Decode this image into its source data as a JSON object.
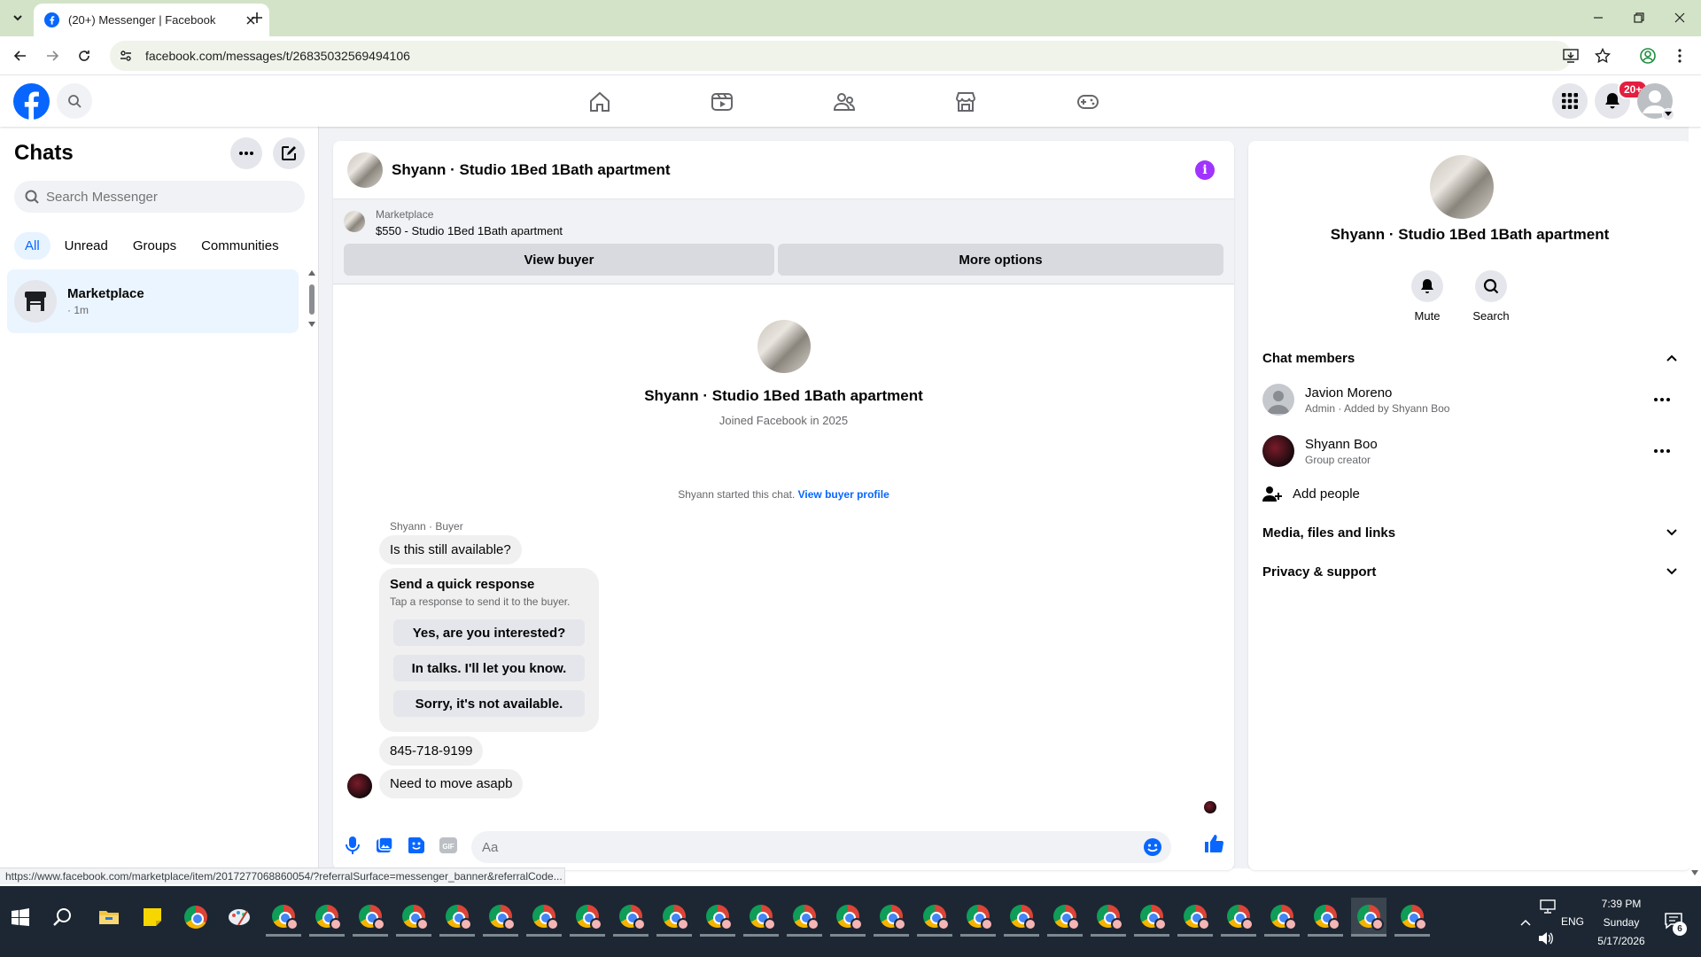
{
  "browser": {
    "tab_title": "(20+) Messenger | Facebook",
    "url": "facebook.com/messages/t/26835032569494106",
    "status_url": "https://www.facebook.com/marketplace/item/2017277068860054/?referralSurface=messenger_banner&referralCode..."
  },
  "fbnav": {
    "notif_badge": "20+",
    "icons": [
      "home-icon",
      "watch-icon",
      "friends-icon",
      "marketplace-icon",
      "gaming-icon"
    ]
  },
  "left": {
    "title": "Chats",
    "search_placeholder": "Search Messenger",
    "filters": [
      "All",
      "Unread",
      "Groups",
      "Communities"
    ],
    "chat": {
      "name": "Marketplace",
      "meta": "· 1m"
    }
  },
  "conversation": {
    "title": "Shyann · Studio 1Bed 1Bath apartment",
    "banner": {
      "label": "Marketplace",
      "listing": "$550 - Studio 1Bed 1Bath apartment",
      "view_buyer": "View buyer",
      "more_options": "More options"
    },
    "profile": {
      "name": "Shyann · Studio 1Bed 1Bath apartment",
      "joined": "Joined Facebook in 2025"
    },
    "started_text": "Shyann started this chat.",
    "started_link": "View buyer profile",
    "sender_label": "Shyann · Buyer",
    "messages": {
      "m1": "Is this still available?",
      "m2": "845-718-9199",
      "m3": "Need to move asapb"
    },
    "quick": {
      "title": "Send a quick response",
      "subtitle": "Tap a response to send it to the buyer.",
      "options": [
        "Yes, are you interested?",
        "In talks. I'll let you know.",
        "Sorry, it's not available."
      ]
    },
    "composer_placeholder": "Aa"
  },
  "right": {
    "name": "Shyann · Studio 1Bed 1Bath apartment",
    "actions": [
      "Mute",
      "Search"
    ],
    "sections": {
      "chat_members": "Chat members",
      "media": "Media, files and links",
      "privacy": "Privacy & support"
    },
    "members": [
      {
        "name": "Javion Moreno",
        "sub": "Admin · Added by Shyann Boo"
      },
      {
        "name": "Shyann Boo",
        "sub": "Group creator"
      }
    ],
    "add_people": "Add people"
  },
  "taskbar": {
    "time": "7:39 PM",
    "day": "Sunday",
    "date": "5/17/2026",
    "lang": "ENG",
    "notif_count": "6"
  }
}
